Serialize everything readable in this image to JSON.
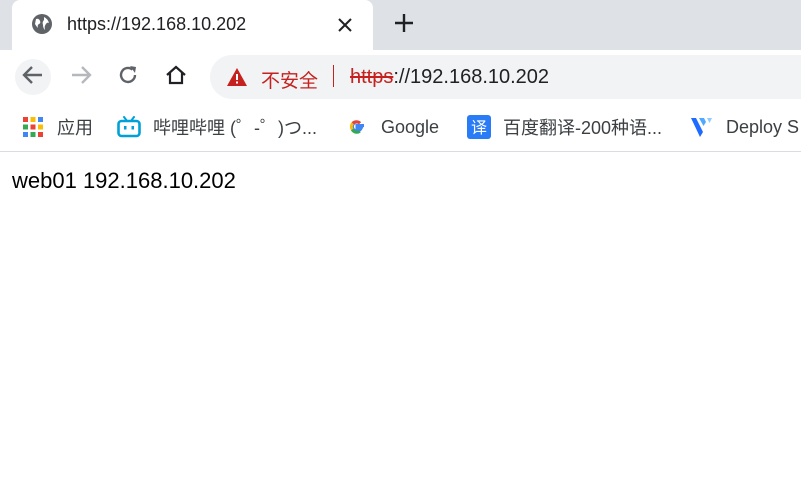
{
  "tab": {
    "title": "https://192.168.10.202",
    "favicon": "globe-icon",
    "close_icon": "close-icon"
  },
  "new_tab_icon": "plus-icon",
  "toolbar": {
    "back_icon": "back-arrow-icon",
    "forward_icon": "forward-arrow-icon",
    "reload_icon": "reload-icon",
    "home_icon": "home-icon"
  },
  "omnibox": {
    "security_icon": "warning-triangle-icon",
    "security_label": "不安全",
    "scheme": "https",
    "rest": "://192.168.10.202"
  },
  "bookmarks": [
    {
      "label": "应用",
      "icon": "apps-grid-icon"
    },
    {
      "label": "哔哩哔哩 (゜-゜)つ...",
      "icon": "bilibili-icon"
    },
    {
      "label": "Google",
      "icon": "google-icon"
    },
    {
      "label": "百度翻译-200种语...",
      "icon": "baidu-translate-icon"
    },
    {
      "label": "Deploy S",
      "icon": "vultr-icon"
    }
  ],
  "page": {
    "body_text": "web01 192.168.10.202"
  },
  "colors": {
    "warning": "#c5221f",
    "tabstrip": "#dee1e6",
    "omnibox_bg": "#f1f3f4",
    "bilibili": "#00a1d6",
    "baidu_translate": "#2a7cf6",
    "vultr": "#1f6bff"
  }
}
